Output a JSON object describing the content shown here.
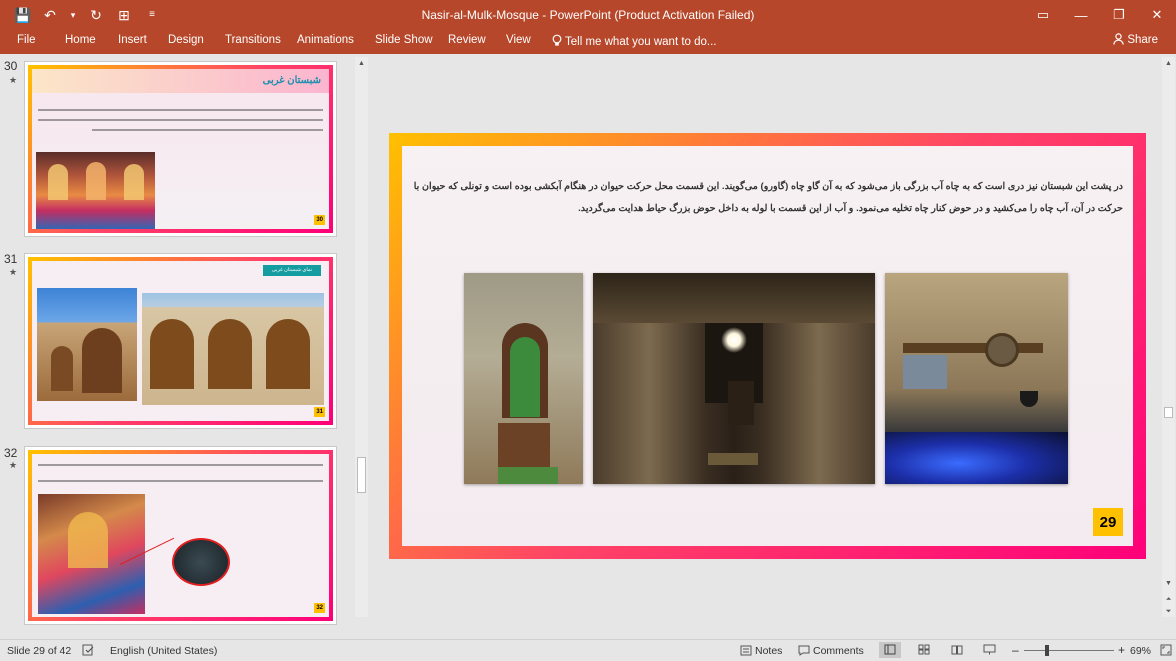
{
  "window": {
    "title": "Nasir-al-Mulk-Mosque - PowerPoint (Product Activation Failed)",
    "controls": [
      "▭",
      "—",
      "❐",
      "✕"
    ]
  },
  "qat": {
    "save": "💾",
    "undo": "↶",
    "undo_arrow": "▾",
    "redo": "↻",
    "present": "⊞",
    "more": "≡"
  },
  "ribbon": {
    "tabs": [
      "File",
      "Home",
      "Insert",
      "Design",
      "Transitions",
      "Animations",
      "Slide Show",
      "Review",
      "View"
    ],
    "tell_me": "Tell me what you want to do...",
    "share": "Share"
  },
  "thumbnails": [
    {
      "number": "30",
      "star": "★",
      "title": "شبستان غربی",
      "page": "30"
    },
    {
      "number": "31",
      "star": "★",
      "title": "نمای شبستان غربی",
      "page": "31"
    },
    {
      "number": "32",
      "star": "★",
      "page": "32"
    }
  ],
  "slide": {
    "text": "در پشت این شبستان نیز دری است که به چاه آب بزرگی باز می‌شود که به آن گاو چاه (گاورو) می‌گویند. این قسمت محل حرکت حیوان در هنگام آبکشی بوده است و تونلی که حیوان با حرکت در آن، آب چاه را می‌کشید و در حوض کنار چاه تخلیه می‌نمود. و آب از این قسمت با لوله به داخل حوض بزرگ حیاط هدایت می‌گردید.",
    "page": "29"
  },
  "status": {
    "slide": "Slide 29 of 42",
    "language": "English (United States)",
    "notes": "Notes",
    "comments": "Comments",
    "zoom": "69%",
    "zoom_minus": "–",
    "zoom_plus": "+"
  },
  "colors": {
    "ribbon": "#b7472a",
    "frame_start": "#ffc000",
    "frame_end": "#ff007a",
    "page_badge": "#ffc000"
  }
}
